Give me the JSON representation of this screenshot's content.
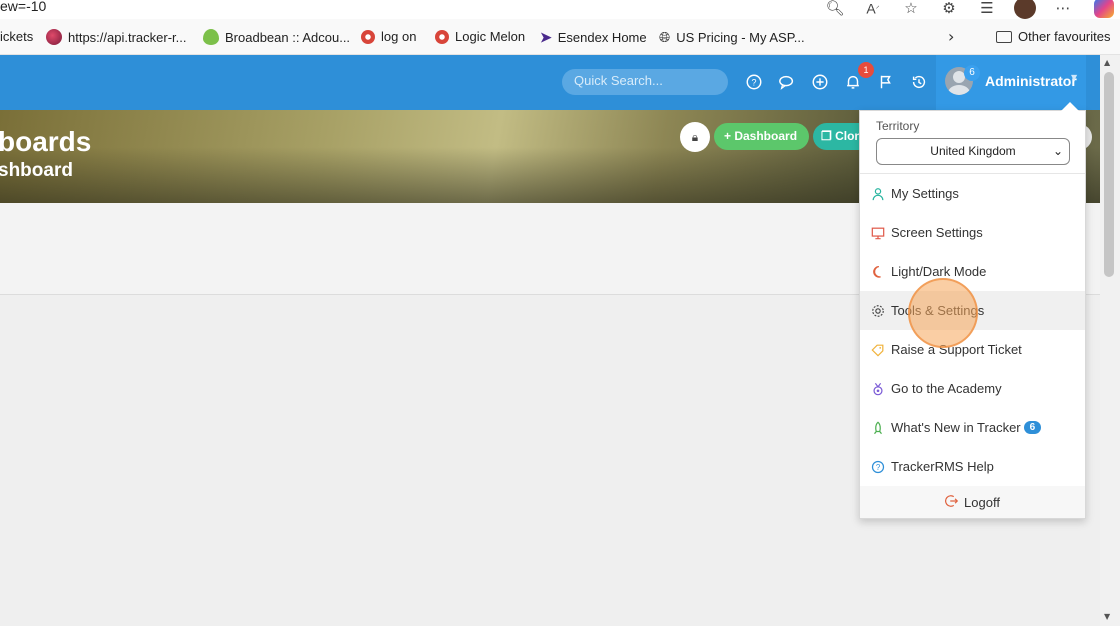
{
  "browser": {
    "url_fragment": "ew=-10",
    "bookmarks": [
      {
        "label": "ickets",
        "icon": "bookmark-icon"
      },
      {
        "label": "https://api.tracker-r...",
        "icon": "grape-icon"
      },
      {
        "label": "Broadbean :: Adcou...",
        "icon": "bean-icon"
      },
      {
        "label": "log on",
        "icon": "logicmelon-icon"
      },
      {
        "label": "Logic Melon",
        "icon": "logicmelon-icon"
      },
      {
        "label": "Esendex Home",
        "icon": "esendex-icon"
      },
      {
        "label": "US Pricing - My ASP...",
        "icon": "globe-icon"
      }
    ],
    "other_favourites": "Other favourites"
  },
  "header": {
    "search_placeholder": "Quick Search...",
    "notification_count": "1",
    "user_badge": "6",
    "user_name": "Administrator"
  },
  "hero": {
    "title": "boards",
    "subtitle": "shboard",
    "dashboard_button": "+ Dashboard",
    "clone_button": "Clon"
  },
  "menu": {
    "territory_label": "Territory",
    "territory_value": "United Kingdom",
    "items": [
      {
        "label": "My Settings",
        "icon": "user-icon",
        "color": "#2ab5a0"
      },
      {
        "label": "Screen Settings",
        "icon": "monitor-icon",
        "color": "#e05a4a"
      },
      {
        "label": "Light/Dark Mode",
        "icon": "moon-icon",
        "color": "#e0623f"
      },
      {
        "label": "Tools & Settings",
        "icon": "gear-icon",
        "color": "#444444"
      },
      {
        "label": "Raise a Support Ticket",
        "icon": "tag-icon",
        "color": "#f0b23a"
      },
      {
        "label": "Go to the Academy",
        "icon": "medal-icon",
        "color": "#7b5bd6"
      },
      {
        "label": "What's New in Tracker",
        "icon": "rocket-icon",
        "color": "#4caf50",
        "badge": "6"
      },
      {
        "label": "TrackerRMS Help",
        "icon": "help-circle-icon",
        "color": "#2e8fd8"
      }
    ],
    "logoff": "Logoff"
  },
  "colors": {
    "header_blue": "#2e8fd8",
    "accent_green": "#5cc76b",
    "accent_teal": "#2cb7a3",
    "badge_red": "#e74c3c"
  }
}
